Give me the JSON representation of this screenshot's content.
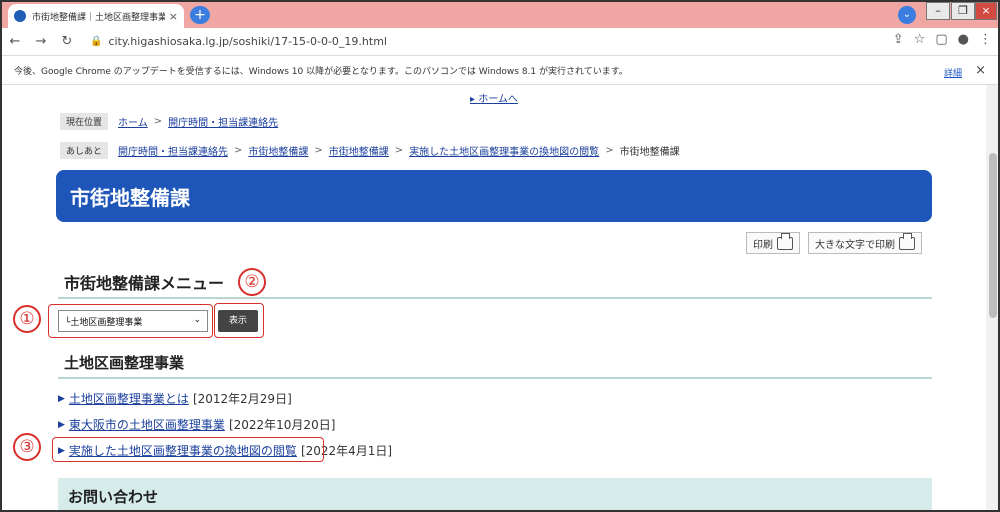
{
  "browser": {
    "tab_title": "市街地整備課｜土地区画整理事業",
    "tab_close": "×",
    "new_tab": "+",
    "url": "city.higashiosaka.lg.jp/soshiki/17-15-0-0-0_19.html",
    "update_notice": "今後、Google Chrome のアップデートを受信するには、Windows 10 以降が必要となります。このパソコンでは Windows 8.1 が実行されています。",
    "update_details": "詳細",
    "update_close": "×"
  },
  "page": {
    "home_link": "ホームへ",
    "current_location": {
      "tag": "現在位置",
      "items": [
        "ホーム",
        "開庁時間・担当課連絡先"
      ]
    },
    "trail": {
      "tag": "あしあと",
      "items": [
        "開庁時間・担当課連絡先",
        "市街地整備課",
        "市街地整備課",
        "実施した土地区画整理事業の換地図の閲覧"
      ],
      "current": "市街地整備課"
    },
    "department_title": "市街地整備課",
    "print_label": "印刷",
    "large_print_label": "大きな文字で印刷",
    "menu_title": "市街地整備課メニュー",
    "select_value": "└土地区画整理事業",
    "show_button": "表示",
    "section_title": "土地区画整理事業",
    "articles": [
      {
        "title": "土地区画整理事業とは",
        "date": "[2012年2月29日]"
      },
      {
        "title": "東大阪市の土地区画整理事業",
        "date": "[2022年10月20日]"
      },
      {
        "title": "実施した土地区画整理事業の換地図の閲覧",
        "date": "[2022年4月1日]"
      }
    ],
    "contact_title": "お問い合わせ"
  },
  "annotations": [
    "①",
    "②",
    "③"
  ]
}
